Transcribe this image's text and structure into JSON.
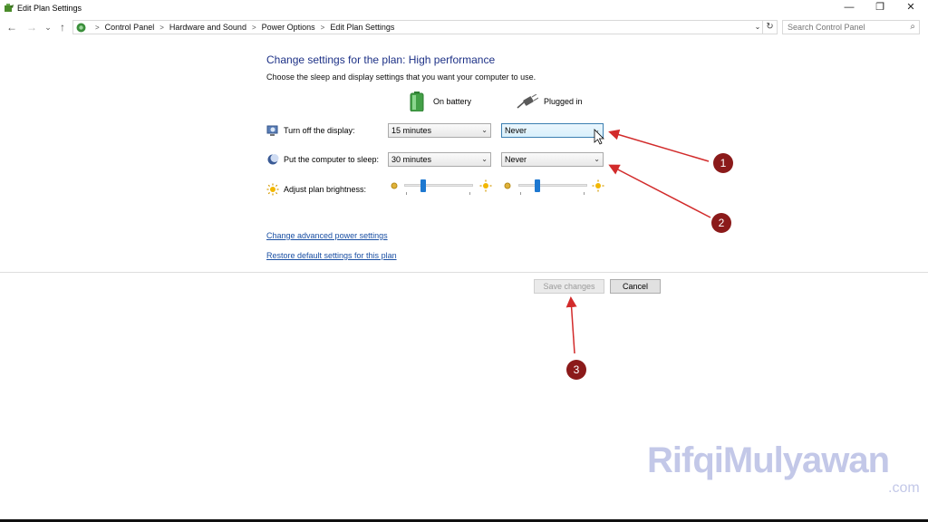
{
  "window": {
    "title": "Edit Plan Settings",
    "controls": {
      "minimize": "—",
      "restore": "❐",
      "close": "✕"
    }
  },
  "nav": {
    "back": "←",
    "forward": "→",
    "recent": "⌄",
    "up": "↑",
    "breadcrumbs": [
      "Control Panel",
      "Hardware and Sound",
      "Power Options",
      "Edit Plan Settings"
    ],
    "separator": ">",
    "dropdown": "⌄",
    "refresh": "↻",
    "search_placeholder": "Search Control Panel",
    "search_icon": "⌕"
  },
  "content": {
    "heading": "Change settings for the plan: High performance",
    "subtext": "Choose the sleep and display settings that you want your computer to use.",
    "col_battery": "On battery",
    "col_plugged": "Plugged in",
    "rows": {
      "display_label": "Turn off the display:",
      "display_battery": "15 minutes",
      "display_plugged": "Never",
      "sleep_label": "Put the computer to sleep:",
      "sleep_battery": "30 minutes",
      "sleep_plugged": "Never",
      "brightness_label": "Adjust plan brightness:"
    },
    "brightness_battery_level": 0.25,
    "brightness_plugged_level": 0.25,
    "links": {
      "advanced": "Change advanced power settings",
      "restore": "Restore default settings for this plan"
    },
    "buttons": {
      "save": "Save changes",
      "cancel": "Cancel"
    }
  },
  "annotations": [
    "1",
    "2",
    "3"
  ],
  "colors": {
    "heading": "#1e3287",
    "link": "#1a4fa3",
    "marker": "#8b1a1a",
    "arrow": "#d22b2b",
    "slider_thumb": "#1e78d0"
  },
  "watermark": {
    "text": "RifqiMulyawan",
    "domain": ".com"
  }
}
